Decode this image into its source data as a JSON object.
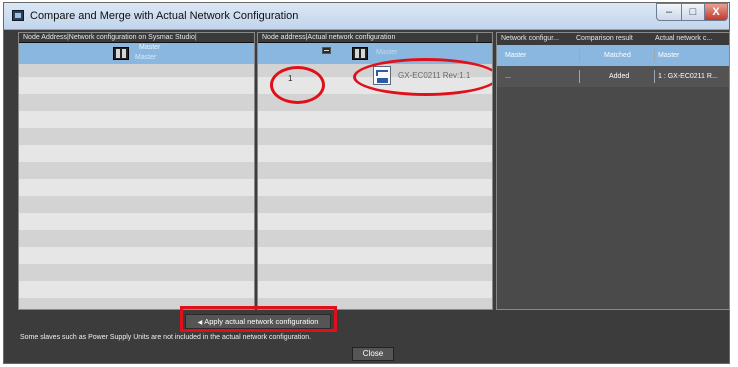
{
  "window": {
    "title": "Compare and Merge with Actual Network Configuration",
    "minimize_glyph": "–",
    "maximize_glyph": "□",
    "close_glyph": "X"
  },
  "left_panel": {
    "header": "Node Address|Network configuration on Sysmac Studio|",
    "master_title": "Master",
    "master_subtitle": "Master"
  },
  "mid_panel": {
    "header": "Node address|Actual network configuration",
    "header_sep": "|",
    "master_title": "Master",
    "node_address": "1",
    "device_label": "GX-EC0211 Rev:1.1"
  },
  "right_panel": {
    "columns": [
      "Network configur...",
      "Comparison result",
      "Actual network c..."
    ],
    "rows": [
      {
        "network": "Master",
        "result": "Matched",
        "actual": "Master"
      },
      {
        "network": "...",
        "result": "Added",
        "actual": "1 : GX-EC0211 R..."
      }
    ]
  },
  "footer": {
    "apply_label": "Apply actual network configuration",
    "note": "Some slaves such as Power Supply Units are not included in the actual network configuration.",
    "close_label": "Close"
  },
  "icons": [
    "app-icon",
    "master-device-icon",
    "collapse-icon",
    "slave-device-icon",
    "arrow-left-icon"
  ],
  "colors": {
    "selection": "#8ab7df",
    "highlight": "#e0101a",
    "dark_background": "#3c3c3c"
  }
}
